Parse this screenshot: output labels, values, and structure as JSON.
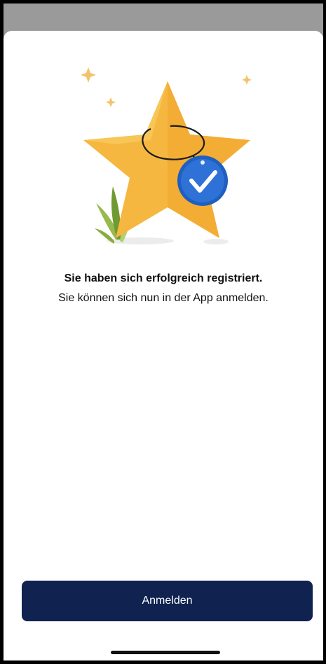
{
  "sheet": {
    "title": "Sie haben sich erfolgreich registriert.",
    "subtitle": "Sie können sich nun in der App anmelden."
  },
  "actions": {
    "login_label": "Anmelden"
  },
  "illustration": {
    "icon": "star-badge-check-icon",
    "colors": {
      "star": "#f5b73f",
      "badge": "#2e72d8",
      "leaf": "#7ea73a"
    }
  },
  "colors": {
    "primary_button": "#0f2250",
    "backdrop": "#9a9a9a",
    "sheet_background": "#ffffff"
  }
}
